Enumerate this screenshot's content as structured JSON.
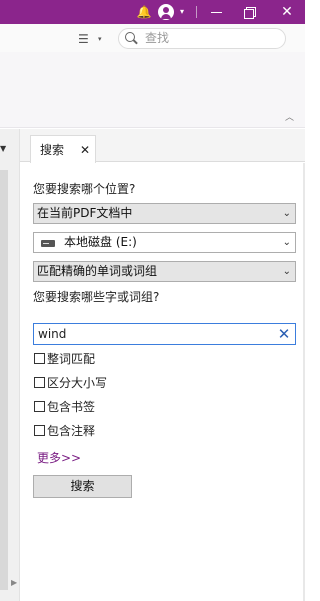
{
  "titlebar": {
    "bg_color": "#8b258c",
    "icons": [
      "bell-icon",
      "account-icon",
      "chevron-down-icon",
      "minimize-icon",
      "restore-icon",
      "close-icon"
    ],
    "bell_glyph": "🔔",
    "acct_caret": "▾",
    "close_glyph": "✕"
  },
  "toolbar": {
    "view_glyph": "☰",
    "view_caret": "▾",
    "search_placeholder": "查找"
  },
  "ribbon": {
    "collapse_glyph": "︿"
  },
  "left_pane": {
    "caret_glyph": "▼",
    "arrow_glyph": "▶"
  },
  "tab": {
    "label": "搜索",
    "close_glyph": "✕"
  },
  "search_panel": {
    "where_label": "您要搜索哪个位置?",
    "where_value": "在当前PDF文档中",
    "drive_value": "本地磁盘 (E:)",
    "match_value": "匹配精确的单词或词组",
    "what_label": "您要搜索哪些字或词组?",
    "query_value": "wind",
    "clear_glyph": "✕",
    "dropdown_caret": "⌄",
    "options": [
      {
        "label": "整词匹配",
        "checked": false
      },
      {
        "label": "区分大小写",
        "checked": false
      },
      {
        "label": "包含书签",
        "checked": false
      },
      {
        "label": "包含注释",
        "checked": false
      }
    ],
    "more_link": "更多>>",
    "search_button": "搜索"
  },
  "colors": {
    "accent": "#8b258c",
    "link": "#7a1d83",
    "input_focus": "#3b7ddd"
  }
}
